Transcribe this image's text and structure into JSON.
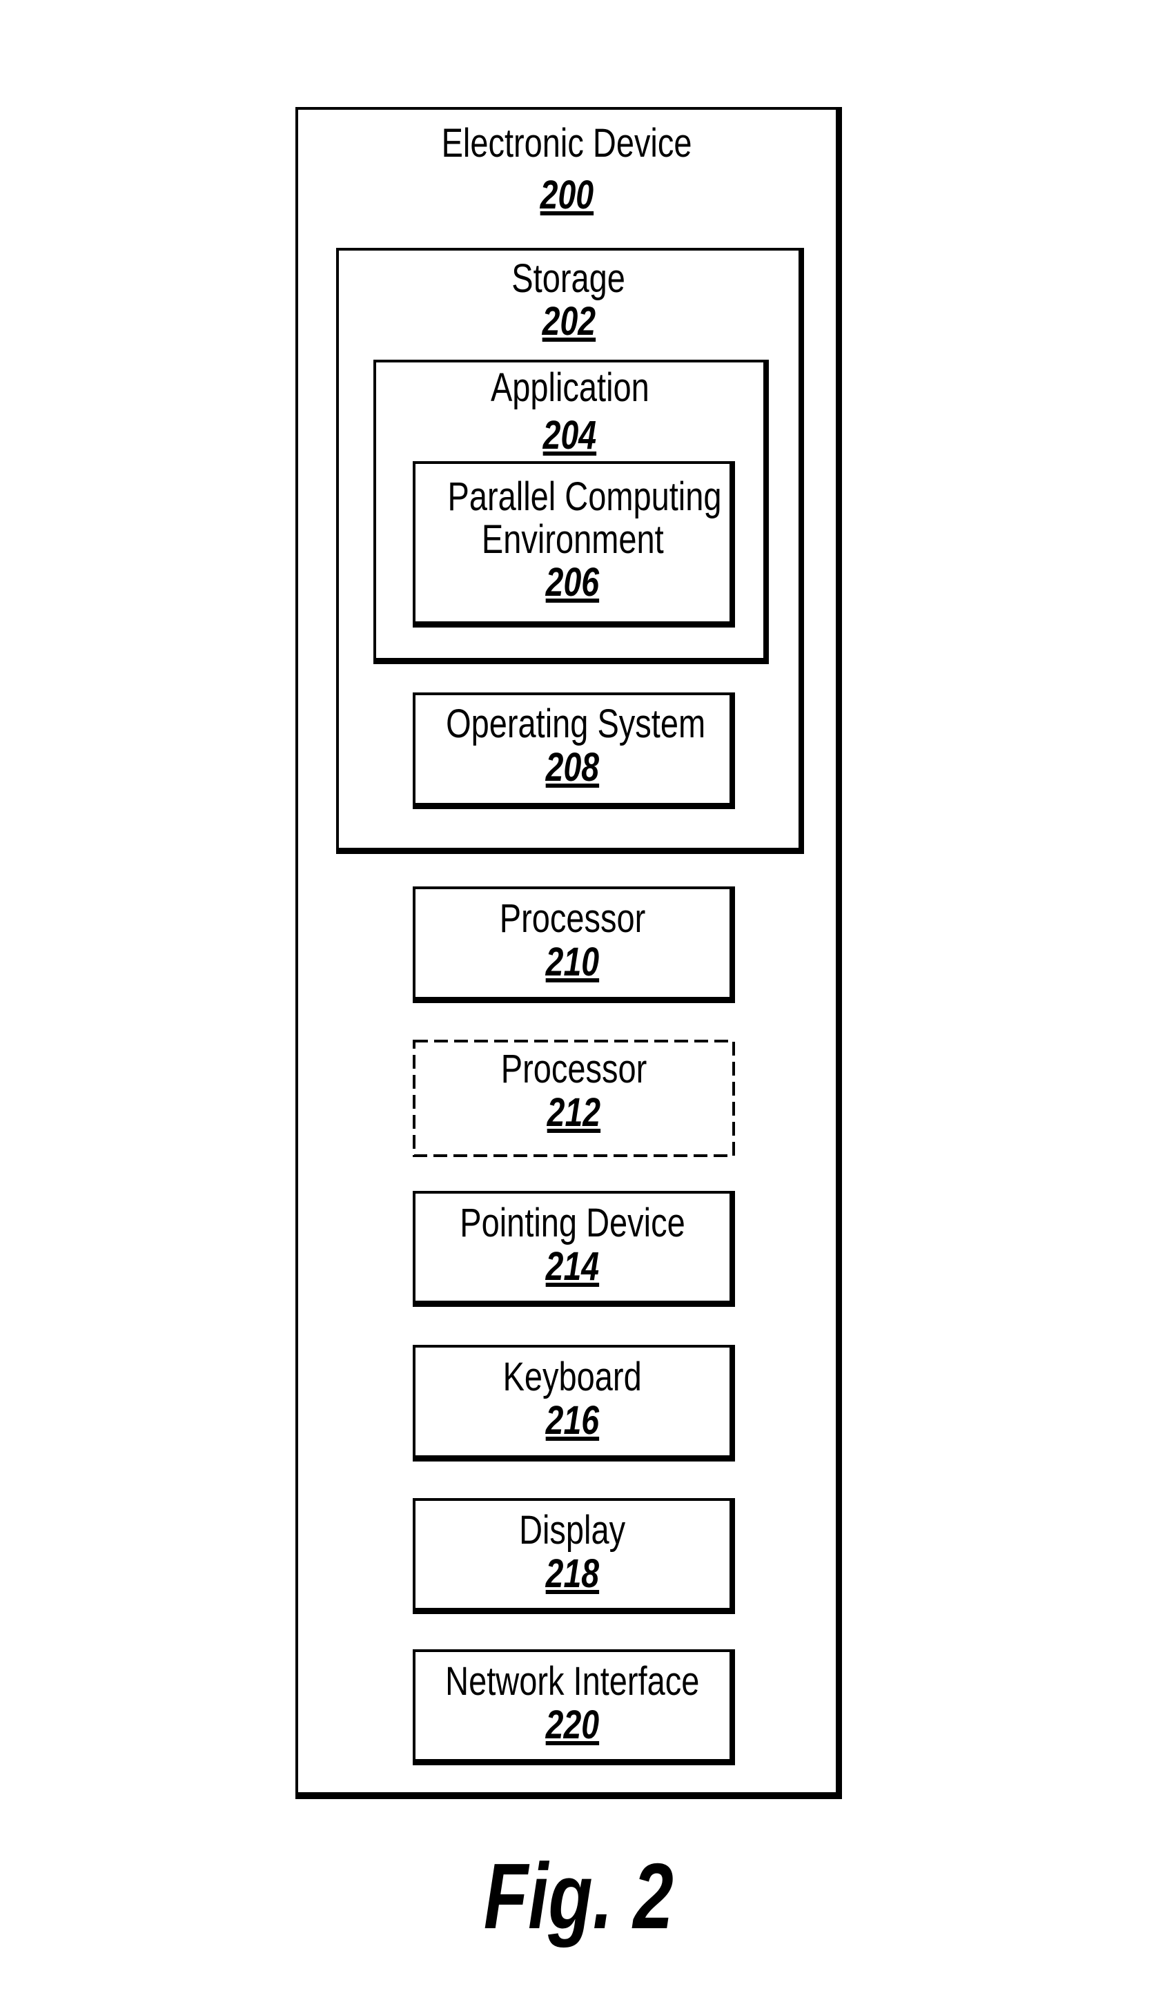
{
  "figure": {
    "caption": "Fig. 2",
    "electronic_device": {
      "label": "Electronic Device",
      "ref": "200"
    },
    "storage": {
      "label": "Storage",
      "ref": "202"
    },
    "application": {
      "label": "Application",
      "ref": "204"
    },
    "parallel_computing_environment": {
      "label_line1": "Parallel Computing",
      "label_line2": "Environment",
      "ref": "206"
    },
    "operating_system": {
      "label": "Operating System",
      "ref": "208"
    },
    "processor_primary": {
      "label": "Processor",
      "ref": "210"
    },
    "processor_optional": {
      "label": "Processor",
      "ref": "212",
      "border_style": "dashed"
    },
    "pointing_device": {
      "label": "Pointing Device",
      "ref": "214"
    },
    "keyboard": {
      "label": "Keyboard",
      "ref": "216"
    },
    "display": {
      "label": "Display",
      "ref": "218"
    },
    "network_interface": {
      "label": "Network Interface",
      "ref": "220"
    }
  }
}
